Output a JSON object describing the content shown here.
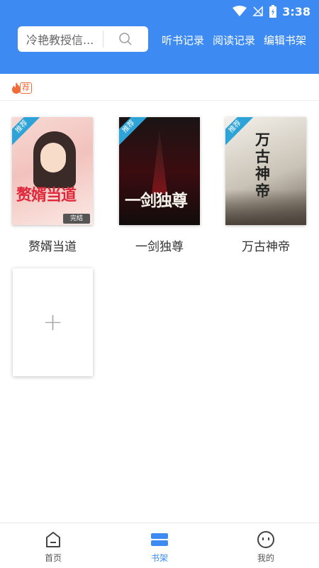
{
  "status_bar": {
    "time": "3:38"
  },
  "search": {
    "placeholder": "冷艳教授信..."
  },
  "header_links": [
    "听书记录",
    "阅读记录",
    "编辑书架"
  ],
  "recommend_tag": "荐",
  "books": [
    {
      "title": "赘婿当道",
      "cover_text": "赘婿当道",
      "ribbon": "推荐",
      "badge": "完结"
    },
    {
      "title": "一剑独尊",
      "cover_text": "一剑独尊",
      "ribbon": "推荐"
    },
    {
      "title": "万古神帝",
      "cover_text": "万古神帝",
      "ribbon": "推荐"
    }
  ],
  "add_book": "+",
  "tabs": [
    {
      "label": "首页",
      "icon": "home-icon",
      "active": false
    },
    {
      "label": "书架",
      "icon": "bookshelf-icon",
      "active": true
    },
    {
      "label": "我的",
      "icon": "profile-icon",
      "active": false
    }
  ],
  "colors": {
    "primary": "#3d8bf2",
    "accent": "#f26b3a"
  }
}
